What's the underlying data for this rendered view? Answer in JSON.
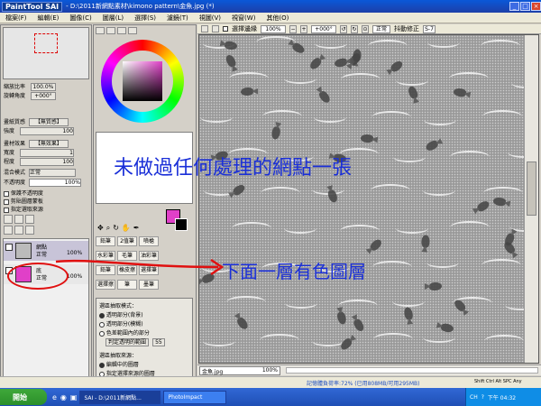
{
  "window": {
    "logo_text": "PaintTool SAI",
    "title": "- D:\\2011新網點素材\\kimono pattern\\金魚.jpg (*)",
    "buttons": [
      "_",
      "□",
      "×"
    ]
  },
  "menu": [
    "檔案(F)",
    "編輯(E)",
    "圖像(C)",
    "圖層(L)",
    "選擇(S)",
    "濾鏡(T)",
    "視圖(V)",
    "視窗(W)",
    "其他(O)"
  ],
  "toolbar": {
    "select_label": "選擇邊緣",
    "zoom": "100%",
    "angle": "+000°",
    "mode": "正常",
    "stabilizer_label": "抖動修正",
    "stabilizer_value": "S-7"
  },
  "navigator": {
    "zoom_label": "縮放比率",
    "zoom_value": "100.0%",
    "rotate_label": "旋轉角度",
    "rotate_value": "+000°"
  },
  "left_panel": {
    "paper_label": "畫紙質感",
    "paper_value": "【無質感】",
    "strength_label": "強度",
    "strength_value": "100",
    "effect_label": "畫材效果",
    "effect_value": "【無效果】",
    "width_label": "寬度",
    "width_value": "1",
    "degree_label": "程度",
    "degree_value": "100",
    "blend_label": "混合模式",
    "blend_value": "正常",
    "opacity_label": "不透明度",
    "opacity_value": "100%",
    "checks": [
      "保護不透明度",
      "剪貼圖層蒙板",
      "指定選取來源"
    ]
  },
  "layers": [
    {
      "name": "網點",
      "mode": "正常",
      "opacity": "100%"
    },
    {
      "name": "底",
      "mode": "正常",
      "opacity": "100%"
    }
  ],
  "tools": {
    "row1": [
      "鉛筆",
      "2值筆",
      "噴槍"
    ],
    "row2": [
      "水彩筆",
      "毛筆",
      "油彩筆"
    ],
    "row3": [
      "鉛筆",
      "橡皮擦",
      "選擇筆"
    ],
    "row4": [
      "選擇擦",
      "筆",
      "墨筆"
    ],
    "options_title": "選區抽取模式：",
    "options": [
      "透明部分(背景)",
      "透明部分(模糊)",
      "色差範圍內的部分"
    ],
    "range_label": "判定透明的範圍",
    "range_value": "55",
    "source_title": "選區抽取來源：",
    "sources": [
      "編輯中的圖層",
      "指定選擇來源的圖層"
    ]
  },
  "annotations": {
    "main": "未做過任何處理的網點一張",
    "sub": "下面一層有色圖層"
  },
  "tab": {
    "filename": "金魚.jpg",
    "zoom": "100%"
  },
  "status": {
    "text": "記憶體負荷率:72% (已用808MB/可用295MB)",
    "keys": "Shift Ctrl Alt SPC Any"
  },
  "taskbar": {
    "start": "開始",
    "items": [
      "SAI - D:\\2011新網點...",
      "PhotoImpact"
    ],
    "lang": "CH",
    "clock": "下午 04:32"
  },
  "colors": {
    "title_blue": "#1d3fa8",
    "annotation_blue": "#1a2fd8",
    "arrow_red": "#e01010",
    "swatch_magenta": "#e040c8"
  }
}
